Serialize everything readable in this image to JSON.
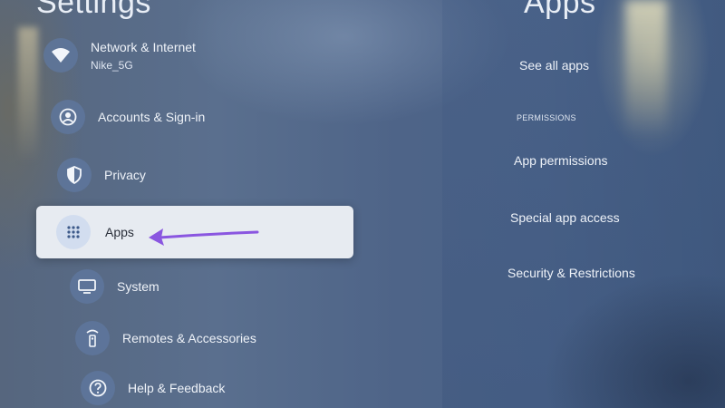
{
  "left_title": "Settings",
  "right_title": "Apps",
  "menu": {
    "network": {
      "label": "Network & Internet",
      "sublabel": "Nike_5G",
      "icon": "wifi-icon"
    },
    "accounts": {
      "label": "Accounts & Sign-in",
      "icon": "account-icon"
    },
    "privacy": {
      "label": "Privacy",
      "icon": "shield-icon"
    },
    "apps": {
      "label": "Apps",
      "icon": "apps-grid-icon"
    },
    "system": {
      "label": "System",
      "icon": "monitor-icon"
    },
    "remotes": {
      "label": "Remotes & Accessories",
      "icon": "remote-icon"
    },
    "help": {
      "label": "Help & Feedback",
      "icon": "help-icon"
    }
  },
  "apps_panel": {
    "see_all": "See all apps",
    "section": "PERMISSIONS",
    "permissions": "App permissions",
    "special_access": "Special app access",
    "security": "Security & Restrictions"
  },
  "colors": {
    "background": "#4e6488",
    "selected_card": "#e7ebf1",
    "arrow": "#8a56e0",
    "text": "#eef2f8"
  }
}
